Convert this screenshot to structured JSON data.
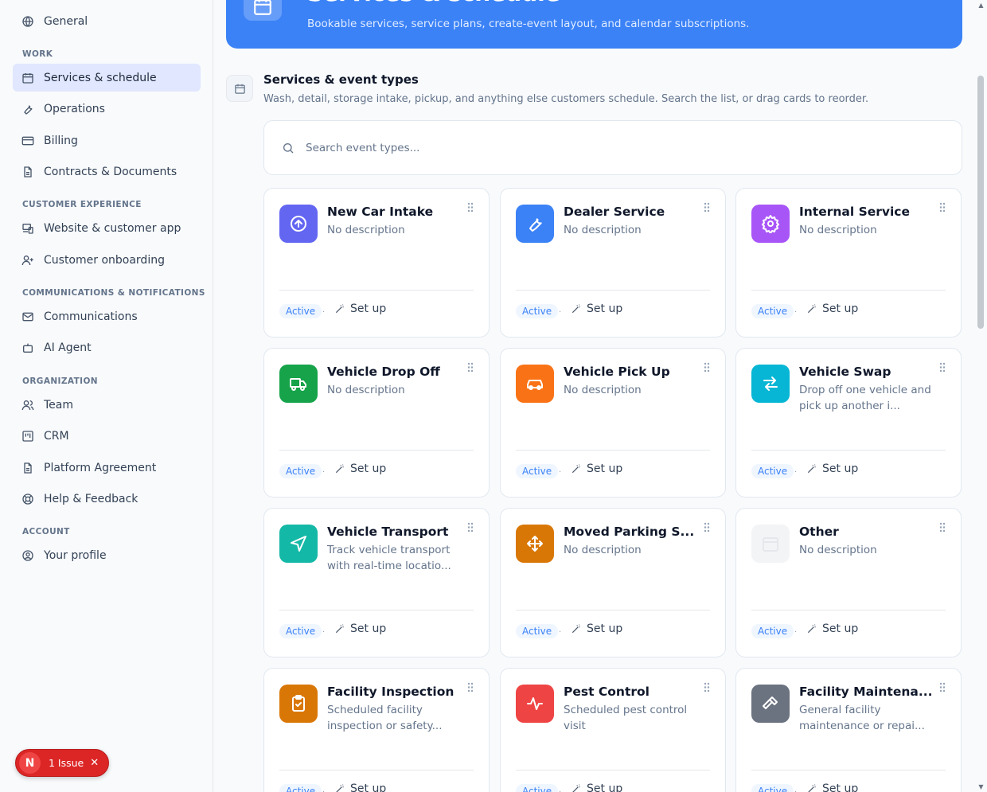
{
  "sidebar": {
    "general": "General",
    "sections": [
      {
        "label": "Work",
        "items": [
          "Services & schedule",
          "Operations",
          "Billing",
          "Contracts & Documents"
        ]
      },
      {
        "label": "Customer Experience",
        "items": [
          "Website & customer app",
          "Customer onboarding"
        ]
      },
      {
        "label": "Communications & Notifications",
        "items": [
          "Communications",
          "AI Agent"
        ]
      },
      {
        "label": "Organization",
        "items": [
          "Team",
          "CRM",
          "Platform Agreement",
          "Help & Feedback"
        ]
      },
      {
        "label": "Account",
        "items": [
          "Your profile"
        ]
      }
    ],
    "active_item": "Services & schedule"
  },
  "hero": {
    "title": "Services & schedule",
    "subtitle": "Bookable services, service plans, create-event layout, and calendar subscriptions."
  },
  "section": {
    "title": "Services & event types",
    "description": "Wash, detail, storage intake, pickup, and anything else customers schedule. Search the list, or drag cards to reorder."
  },
  "search": {
    "placeholder": "Search event types...",
    "value": ""
  },
  "cards": [
    {
      "title": "New Car Intake",
      "description": "No description",
      "status": "Active",
      "action": "Set up",
      "icon": "arrow-up-circle-icon",
      "color": "#6366f1"
    },
    {
      "title": "Dealer Service",
      "description": "No description",
      "status": "Active",
      "action": "Set up",
      "icon": "wrench-icon",
      "color": "#3b82f6"
    },
    {
      "title": "Internal Service",
      "description": "No description",
      "status": "Active",
      "action": "Set up",
      "icon": "gear-icon",
      "color": "#a855f7"
    },
    {
      "title": "Vehicle Drop Off",
      "description": "No description",
      "status": "Active",
      "action": "Set up",
      "icon": "truck-icon",
      "color": "#16a34a"
    },
    {
      "title": "Vehicle Pick Up",
      "description": "No description",
      "status": "Active",
      "action": "Set up",
      "icon": "car-icon",
      "color": "#f97316"
    },
    {
      "title": "Vehicle Swap",
      "description": "Drop off one vehicle and pick up another i...",
      "status": "Active",
      "action": "Set up",
      "icon": "swap-arrows-icon",
      "color": "#06b6d4"
    },
    {
      "title": "Vehicle Transport",
      "description": "Track vehicle transport with real-time locatio...",
      "status": "Active",
      "action": "Set up",
      "icon": "navigation-arrow-icon",
      "color": "#14b8a6"
    },
    {
      "title": "Moved Parking S...",
      "description": "No description",
      "status": "Active",
      "action": "Set up",
      "icon": "move-arrows-icon",
      "color": "#d97706"
    },
    {
      "title": "Other",
      "description": "No description",
      "status": "Active",
      "action": "Set up",
      "icon": "calendar-icon",
      "color": "#f3f4f6"
    },
    {
      "title": "Facility Inspection",
      "description": "Scheduled facility inspection or safety...",
      "status": "Active",
      "action": "Set up",
      "icon": "clipboard-check-icon",
      "color": "#d97706"
    },
    {
      "title": "Pest Control",
      "description": "Scheduled pest control visit",
      "status": "Active",
      "action": "Set up",
      "icon": "activity-pulse-icon",
      "color": "#ef4444"
    },
    {
      "title": "Facility Maintena...",
      "description": "General facility maintenance or repai...",
      "status": "Active",
      "action": "Set up",
      "icon": "hammer-icon",
      "color": "#6b7280"
    }
  ],
  "issue_pill": {
    "avatar": "N",
    "label": "1 Issue"
  }
}
